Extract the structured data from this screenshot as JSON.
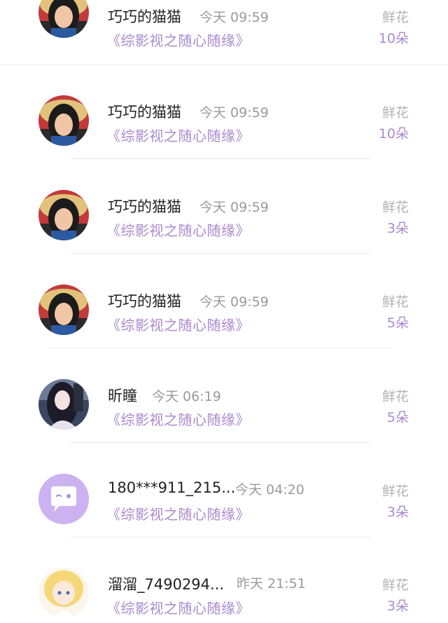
{
  "colors": {
    "name_text": "#222222",
    "meta_text": "#9a9a9a",
    "accent_purple": "#a98ad0",
    "avatar_purple_bg": "#cdb2f1"
  },
  "records": [
    {
      "user": "巧巧的猫猫",
      "time": "今天 09:59",
      "work": "《综影视之随心随缘》",
      "gift": "鲜花",
      "count": "10朵",
      "avatar": "woman-hat"
    },
    {
      "user": "巧巧的猫猫",
      "time": "今天 09:59",
      "work": "《综影视之随心随缘》",
      "gift": "鲜花",
      "count": "10朵",
      "avatar": "woman-hat"
    },
    {
      "user": "巧巧的猫猫",
      "time": "今天 09:59",
      "work": "《综影视之随心随缘》",
      "gift": "鲜花",
      "count": "3朵",
      "avatar": "woman-hat"
    },
    {
      "user": "巧巧的猫猫",
      "time": "今天 09:59",
      "work": "《综影视之随心随缘》",
      "gift": "鲜花",
      "count": "5朵",
      "avatar": "woman-hat"
    },
    {
      "user": "昕瞳",
      "time": "今天 06:19",
      "work": "《综影视之随心随缘》",
      "gift": "鲜花",
      "count": "5朵",
      "avatar": "anime-girl"
    },
    {
      "user": "180***911_215...",
      "time": "今天 04:20",
      "work": "《综影视之随心随缘》",
      "gift": "鲜花",
      "count": "3朵",
      "avatar": "default-chat-bubble"
    },
    {
      "user": "溜溜_7490294...",
      "time": "昨天 21:51",
      "work": "《综影视之随心随缘》",
      "gift": "鲜花",
      "count": "3朵",
      "avatar": "cartoon-blonde-girl"
    }
  ]
}
